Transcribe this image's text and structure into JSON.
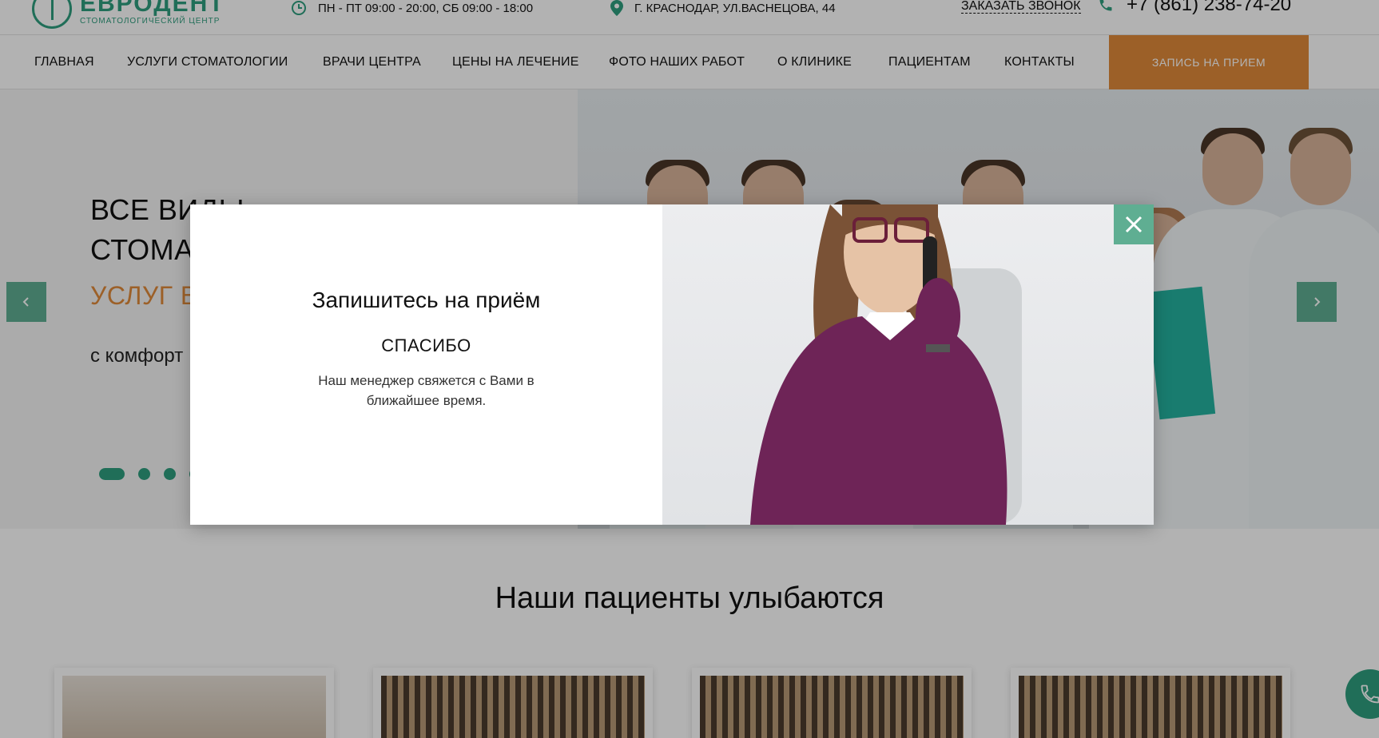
{
  "header": {
    "logo_name": "ЕВРОДЕНТ",
    "logo_sub": "СТОМАТОЛОГИЧЕСКИЙ ЦЕНТР",
    "hours": "ПН - ПТ 09:00 - 20:00, СБ 09:00 - 18:00",
    "address": "Г. КРАСНОДАР, УЛ.ВАСНЕЦОВА, 44",
    "callback_label": "ЗАКАЗАТЬ ЗВОНОК",
    "phone": "+7 (861) 238-74-20"
  },
  "nav": {
    "items": [
      {
        "label": "ГЛАВНАЯ"
      },
      {
        "label": "УСЛУГИ СТОМАТОЛОГИИ"
      },
      {
        "label": "ВРАЧИ ЦЕНТРА"
      },
      {
        "label": "ЦЕНЫ НА ЛЕЧЕНИЕ"
      },
      {
        "label": "ФОТО НАШИХ РАБОТ"
      },
      {
        "label": "О КЛИНИКЕ"
      },
      {
        "label": "ПАЦИЕНТАМ"
      },
      {
        "label": "КОНТАКТЫ"
      }
    ],
    "book_label": "ЗАПИСЬ НА ПРИЕМ"
  },
  "hero": {
    "line1": "ВСЕ ВИДЫ",
    "line2": "СТОМА",
    "orange": "УСЛУГ В",
    "sub": "с комфорт",
    "slides_total": 4,
    "active_slide": 1
  },
  "section": {
    "title": "Наши пациенты улыбаются"
  },
  "modal": {
    "title": "Запишитесь на приём",
    "thanks": "СПАСИБО",
    "message": "Наш менеджер свяжется с Вами в ближайшее время."
  },
  "icons": {
    "clock": "clock-icon",
    "pin": "map-pin-icon",
    "phone": "phone-icon",
    "close": "close-icon",
    "prev": "chevron-left-icon",
    "next": "chevron-right-icon"
  },
  "colors": {
    "brand_green": "#2f9e7e",
    "accent_orange": "#e08a3a",
    "button_green": "#5fae92"
  }
}
